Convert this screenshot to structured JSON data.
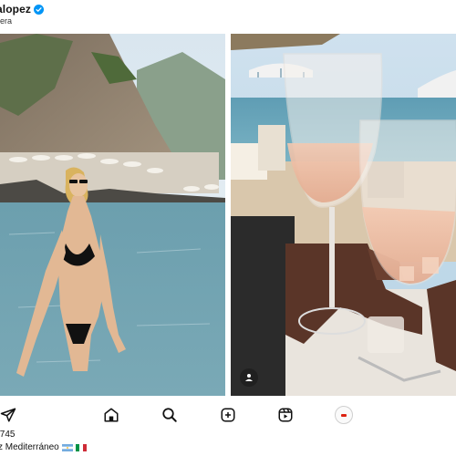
{
  "header": {
    "username": "alopez",
    "verified": true,
    "location": "liera"
  },
  "photos": [
    {
      "name": "left-photo",
      "description": "beach"
    },
    {
      "name": "right-photo",
      "description": "wine"
    }
  ],
  "nav": {
    "icons": [
      "send-icon",
      "home-icon",
      "search-icon",
      "create-icon",
      "reels-icon",
      "profile-icon"
    ]
  },
  "post": {
    "likes": ".745",
    "caption": "z Mediterráneo",
    "caption_flags": [
      "flag-ar",
      "flag-it"
    ]
  },
  "colors": {
    "verified_blue": "#0095f6",
    "sea": "#5f9db4",
    "sky": "#cfe3f2"
  }
}
